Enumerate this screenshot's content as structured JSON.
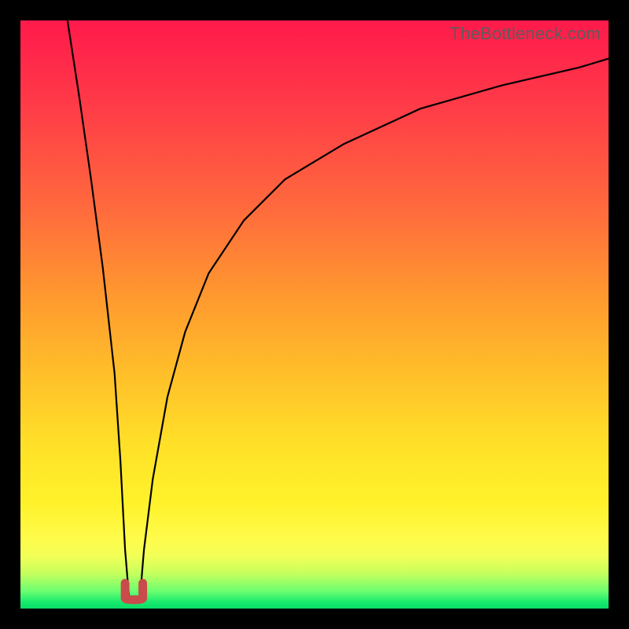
{
  "watermark": "TheBottleneck.com",
  "colors": {
    "frame": "#000000",
    "watermark_text": "#5c5c5c",
    "curve_stroke": "#000000",
    "valley_stroke": "#c94b4b",
    "gradient_top": "#ff1a4b",
    "gradient_bottom": "#0bdc67"
  },
  "chart_data": {
    "type": "line",
    "title": "",
    "xlabel": "",
    "ylabel": "",
    "xlim": [
      0,
      100
    ],
    "ylim": [
      0,
      100
    ],
    "grid": false,
    "legend": false,
    "series": [
      {
        "name": "left-branch",
        "x": [
          8.0,
          10.0,
          12.0,
          14.0,
          16.0,
          17.0,
          17.8,
          18.5
        ],
        "values": [
          100,
          87,
          73,
          58,
          40,
          25,
          10,
          1.5
        ]
      },
      {
        "name": "right-branch",
        "x": [
          20.3,
          21.0,
          22.5,
          25.0,
          28.0,
          32.0,
          38.0,
          45.0,
          55.0,
          68.0,
          82.0,
          95.0,
          100.0
        ],
        "values": [
          1.5,
          10,
          22,
          36,
          47,
          57,
          66,
          73,
          79,
          85,
          89,
          92,
          93.5
        ]
      }
    ],
    "annotations": [
      {
        "name": "valley-marker-U",
        "x_range": [
          17.8,
          20.8
        ],
        "y": 1.5,
        "color": "#c94b4b"
      }
    ]
  }
}
